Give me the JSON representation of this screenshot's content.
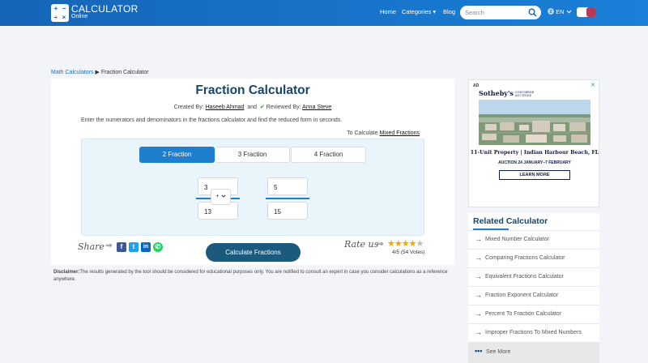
{
  "header": {
    "logo_symbols": [
      "+",
      "−",
      "÷",
      "×"
    ],
    "logo_title": "CALCULATOR",
    "logo_sub": "Online",
    "nav": [
      "Home",
      "Categories ▾",
      "Blog"
    ],
    "search_placeholder": "Search",
    "lang": "EN",
    "accent": "#1565b8"
  },
  "breadcrumb": {
    "parent": "Math Calculators",
    "separator": "▶",
    "current": "Fraction Calculator"
  },
  "calculator": {
    "title": "Fraction Calculator",
    "created_by_label": "Created By:",
    "created_by": "Haseeb Ahmad",
    "and": "and",
    "reviewed_mark": "✔",
    "reviewed_label": "Reviewed By:",
    "reviewed_by": "Anna Steve",
    "intro": "Enter the numerators and denominators in the fractions calculator and find the reduced form in seconds.",
    "to_calc_label": "To Calculate",
    "to_calc_link": "Mixed Fractions",
    "tabs": [
      "2 Fraction",
      "3 Fraction",
      "4 Fraction"
    ],
    "active_tab": "2 Fraction",
    "fraction1": {
      "numerator": "3",
      "denominator": "13"
    },
    "operator": "+",
    "fraction2": {
      "numerator": "5",
      "denominator": "15"
    },
    "share_label": "Share",
    "share_arrow": "⇒",
    "social_icons": [
      "facebook-icon",
      "twitter-icon",
      "linkedin-icon",
      "whatsapp-icon"
    ],
    "calculate_button": "Calculate Fractions",
    "rate_label": "Rate us",
    "rating_stars_filled": "★★★★",
    "rating_stars_empty": "★",
    "rating_text": "4/5 (54 Votes)"
  },
  "disclaimer": {
    "label": "Disclaimer:",
    "text": "The results generated by the tool should be considered for educational purposes only. You are notified to consult an expert in case you consider calculations as a reference anywhere."
  },
  "ad": {
    "tag": "AD",
    "close": "✕",
    "brand": "Sotheby's",
    "brand_sub1": "CONCIERGE",
    "brand_sub2": "AUCTIONS",
    "headline": "11-Unit Property | Indian Harbour Beach, FL",
    "auction": "AUCTION  24 JANUARY–7 FEBRUARY",
    "button": "LEARN MORE"
  },
  "related": {
    "title": "Related Calculator",
    "items": [
      "Mixed Number Calculator",
      "Comparing Fractions Calculator",
      "Equivalent Fractions Calculator",
      "Fraction Exponent Calculator",
      "Percent To Fraction Calculator",
      "Improper Fractions To Mixed Numbers"
    ],
    "see_more": "See More"
  }
}
